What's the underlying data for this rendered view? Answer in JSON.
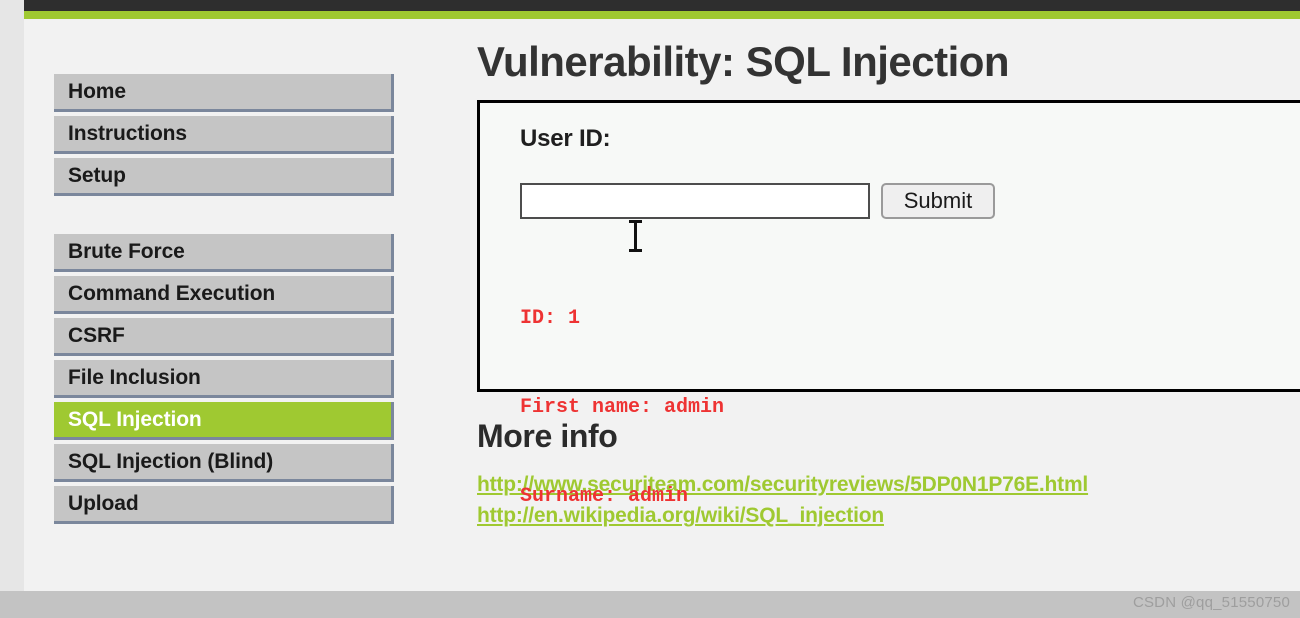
{
  "theme": {
    "topbar_dark": "#2e2e2e",
    "accent_green": "#9fc931",
    "page_bg": "#f2f2f2",
    "nav_bg": "#c5c5c5",
    "nav_shadow": "#7b879c",
    "result_red": "#ee3333",
    "bottom_band": "#c3c3c3"
  },
  "sidebar": {
    "group_main": [
      {
        "label": "Home",
        "active": false
      },
      {
        "label": "Instructions",
        "active": false
      },
      {
        "label": "Setup",
        "active": false
      }
    ],
    "group_vulns": [
      {
        "label": "Brute Force",
        "active": false
      },
      {
        "label": "Command Execution",
        "active": false
      },
      {
        "label": "CSRF",
        "active": false
      },
      {
        "label": "File Inclusion",
        "active": false
      },
      {
        "label": "SQL Injection",
        "active": true
      },
      {
        "label": "SQL Injection (Blind)",
        "active": false
      },
      {
        "label": "Upload",
        "active": false
      }
    ]
  },
  "main": {
    "title": "Vulnerability: SQL Injection",
    "form": {
      "label": "User ID:",
      "input_value": "",
      "input_placeholder": "",
      "submit_label": "Submit"
    },
    "result": {
      "id_line": "ID: 1",
      "first_name_line": "First name: admin",
      "surname_line": "Surname: admin"
    },
    "more_info": {
      "heading": "More info",
      "links": [
        "http://www.securiteam.com/securityreviews/5DP0N1P76E.html",
        "http://en.wikipedia.org/wiki/SQL_injection"
      ]
    }
  },
  "watermark": {
    "text": "CSDN @qq_51550750"
  }
}
